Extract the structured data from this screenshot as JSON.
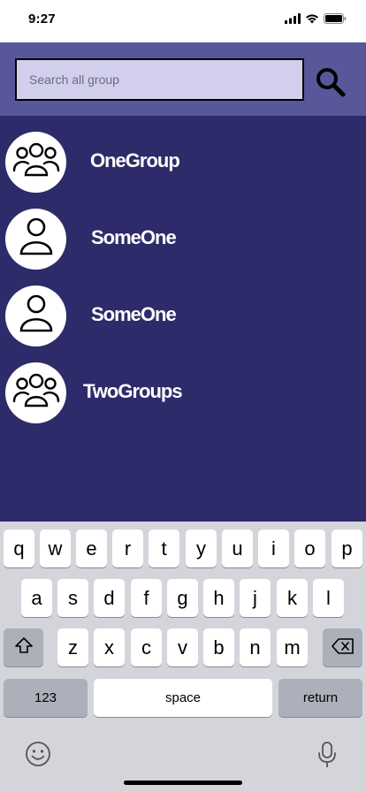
{
  "status_bar": {
    "time": "9:27",
    "icons": [
      "cellular-signal-icon",
      "wifi-icon",
      "battery-icon"
    ]
  },
  "search": {
    "placeholder": "Search all group",
    "value": "",
    "icon": "search-icon"
  },
  "list": {
    "items": [
      {
        "label": "OneGroup",
        "icon": "group-icon"
      },
      {
        "label": "SomeOne",
        "icon": "person-icon"
      },
      {
        "label": "SomeOne",
        "icon": "person-icon"
      },
      {
        "label": "TwoGroups",
        "icon": "group-icon"
      }
    ]
  },
  "keyboard": {
    "row1": [
      "q",
      "w",
      "e",
      "r",
      "t",
      "y",
      "u",
      "i",
      "o",
      "p"
    ],
    "row2": [
      "a",
      "s",
      "d",
      "f",
      "g",
      "h",
      "j",
      "k",
      "l"
    ],
    "row3": [
      "z",
      "x",
      "c",
      "v",
      "b",
      "n",
      "m"
    ],
    "numbers_label": "123",
    "space_label": "space",
    "return_label": "return",
    "shift_icon": "shift-icon",
    "delete_icon": "delete-icon",
    "emoji_icon": "emoji-icon",
    "mic_icon": "microphone-icon"
  },
  "colors": {
    "header_bg": "#57579a",
    "list_bg": "#2e2b6a",
    "search_bg": "#d2cfec",
    "keyboard_bg": "#d3d5db"
  }
}
